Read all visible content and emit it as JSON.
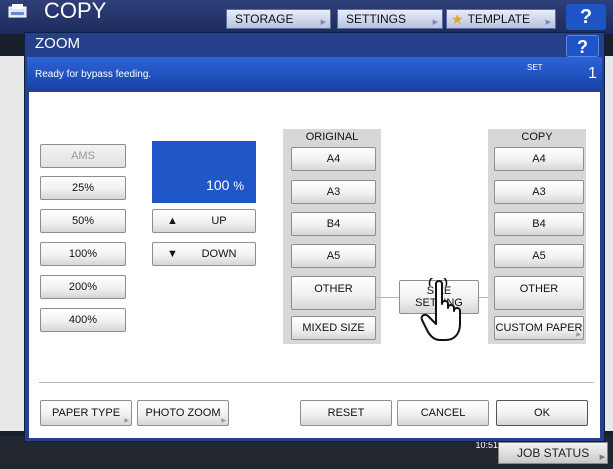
{
  "background": {
    "app_title": "COPY",
    "tabs": [
      {
        "label": "STORAGE"
      },
      {
        "label": "SETTINGS"
      },
      {
        "label": "TEMPLATE"
      }
    ],
    "help_label": "?",
    "time": "10:51",
    "job_status_label": "JOB STATUS"
  },
  "dialog": {
    "title": "ZOOM",
    "help_label": "?",
    "status_message": "Ready for bypass feeding.",
    "set_label": "SET",
    "set_count": "1"
  },
  "zoom": {
    "presets": [
      "AMS",
      "25%",
      "50%",
      "100%",
      "200%",
      "400%"
    ],
    "value": "100",
    "unit": "%",
    "up_label": "UP",
    "down_label": "DOWN"
  },
  "original": {
    "header": "ORIGINAL",
    "sizes": [
      "A4",
      "A3",
      "B4",
      "A5"
    ],
    "other_label": "OTHER",
    "mixed_label": "MIXED SIZE"
  },
  "size_setting": {
    "line1": "SIZE",
    "line2": "SETTING"
  },
  "copy": {
    "header": "COPY",
    "sizes": [
      "A4",
      "A3",
      "B4",
      "A5"
    ],
    "other_label": "OTHER",
    "custom_label": "CUSTOM PAPER"
  },
  "footer": {
    "paper_type_label": "PAPER TYPE",
    "photo_zoom_label": "PHOTO ZOOM",
    "reset_label": "RESET",
    "cancel_label": "CANCEL",
    "ok_label": "OK"
  }
}
